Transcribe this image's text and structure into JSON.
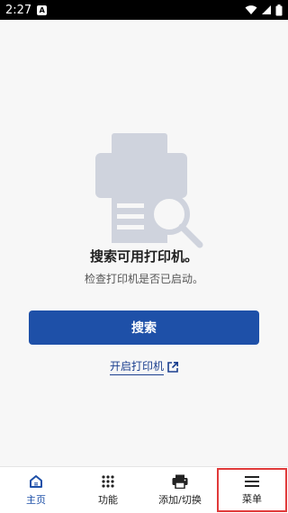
{
  "status_bar": {
    "time": "2:27",
    "app_icon_letter": "A"
  },
  "empty_state": {
    "title": "搜索可用打印机。",
    "subtitle": "检查打印机是否已启动。"
  },
  "actions": {
    "search_label": "搜索",
    "open_printer_label": "开启打印机"
  },
  "bottom_nav": {
    "items": [
      {
        "label": "主页",
        "icon": "home-icon",
        "active": true
      },
      {
        "label": "功能",
        "icon": "grid-dots-icon",
        "active": false
      },
      {
        "label": "添加/切换",
        "icon": "printer-icon",
        "active": false
      },
      {
        "label": "菜单",
        "icon": "hamburger-menu-icon",
        "active": false,
        "highlighted": true
      }
    ]
  },
  "colors": {
    "accent": "#1e50a8",
    "highlight_box": "#e03a3a",
    "illustration": "#cfd3dd"
  }
}
